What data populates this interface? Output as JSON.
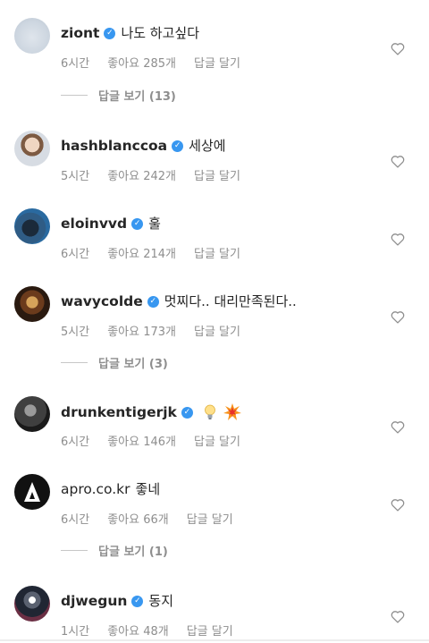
{
  "comments": [
    {
      "username": "ziont",
      "verified": true,
      "text": "나도 하고싶다",
      "time": "6시간",
      "likes": "좋아요 285개",
      "reply": "답글 달기",
      "replies_toggle": "답글 보기 (13)"
    },
    {
      "username": "hashblanccoa",
      "verified": true,
      "text": "세상에",
      "time": "5시간",
      "likes": "좋아요 242개",
      "reply": "답글 달기"
    },
    {
      "username": "eloinvvd",
      "verified": true,
      "text": "훌",
      "time": "6시간",
      "likes": "좋아요 214개",
      "reply": "답글 달기"
    },
    {
      "username": "wavycolde",
      "verified": true,
      "text": "멋찌다.. 대리만족된다..",
      "time": "5시간",
      "likes": "좋아요 173개",
      "reply": "답글 달기",
      "replies_toggle": "답글 보기 (3)"
    },
    {
      "username": "drunkentigerjk",
      "verified": true,
      "text": "",
      "emojis": [
        "lightbulb-emoji",
        "collision-emoji"
      ],
      "time": "6시간",
      "likes": "좋아요 146개",
      "reply": "답글 달기"
    },
    {
      "username": "apro.co.kr",
      "verified": false,
      "text": "좋네",
      "time": "6시간",
      "likes": "좋아요 66개",
      "reply": "답글 달기",
      "replies_toggle": "답글 보기 (1)"
    },
    {
      "username": "djwegun",
      "verified": true,
      "text": "동지",
      "time": "1시간",
      "likes": "좋아요 48개",
      "reply": "답글 달기"
    }
  ],
  "colors": {
    "verified_badge": "#3897f0",
    "meta_text": "#8e8e8e",
    "primary_text": "#262626"
  },
  "icons": {
    "like": "heart-outline-icon",
    "verified": "verified-check-icon"
  }
}
